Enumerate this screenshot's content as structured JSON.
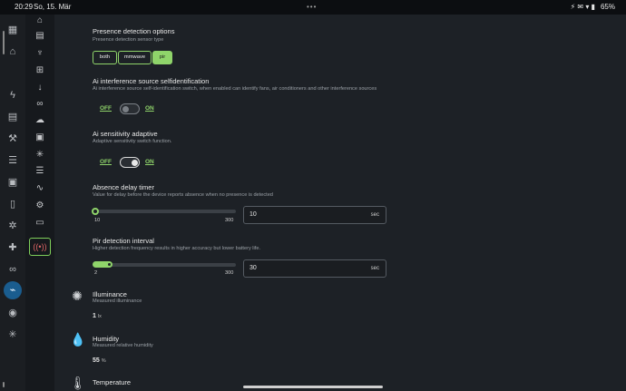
{
  "status_bar": {
    "time": "20:29",
    "date": "So, 15. Mär",
    "dots": "•••",
    "indicators": "⚡ ✉ ▾ ▮",
    "battery": "65%"
  },
  "rail_icons": [
    "dashboard-icon",
    "home-icon",
    "bolt-icon",
    "chart-icon",
    "wrench-icon",
    "list-icon",
    "grid-icon",
    "device-icon",
    "hub-icon",
    "puzzle-icon",
    "link-icon",
    "esphome-icon",
    "compass-icon",
    "network-icon"
  ],
  "sidenav_icons": [
    "device-home-icon",
    "panel-icon",
    "plug-icon",
    "grid-icon",
    "arrow-down-icon",
    "link-icon",
    "cloud-icon",
    "android-icon",
    "sparkle-icon",
    "list-icon",
    "wave-icon",
    "cogs-icon",
    "monitor-icon"
  ],
  "sidenav_selected_icon": "radio-tower-icon",
  "presence": {
    "title": "Presence detection options",
    "desc": "Presence detection sensor type",
    "options": [
      "both",
      "mmwave",
      "pir"
    ],
    "selected": "pir"
  },
  "ai_self_id": {
    "title": "Ai interference source selfidentification",
    "desc": "Ai interference source self-identification switch, when enabled can identify fans, air conditioners and other interference sources",
    "off_label": "OFF",
    "on_label": "ON",
    "state": "off"
  },
  "ai_sensitivity": {
    "title": "Ai sensitivity adaptive",
    "desc": "Adaptive sensitivity switch function.",
    "off_label": "OFF",
    "on_label": "ON",
    "state": "on"
  },
  "absence_delay": {
    "title": "Absence delay timer",
    "desc": "Value for delay before the device reports absence when no presence is detected",
    "min": "10",
    "max": "300",
    "value": "10",
    "unit": "sec",
    "fraction": 0.0
  },
  "pir_interval": {
    "title": "Pir detection interval",
    "desc": "Higher detection frequency results in higher accuracy but lower battery life.",
    "min": "2",
    "max": "300",
    "value": "30",
    "unit": "sec",
    "fraction": 0.094
  },
  "illuminance": {
    "title": "Illuminance",
    "desc": "Measured illuminance",
    "value": "1",
    "unit": "lx",
    "icon": "sun-gear-icon"
  },
  "humidity": {
    "title": "Humidity",
    "desc": "Measured relative humidity",
    "value": "55",
    "unit": "%",
    "icon": "water-drop-icon"
  },
  "temperature": {
    "title": "Temperature",
    "icon": "thermometer-icon"
  },
  "colors": {
    "accent": "#8fd46a",
    "active_nav": "#1a5d8f",
    "background": "#1d2126"
  }
}
